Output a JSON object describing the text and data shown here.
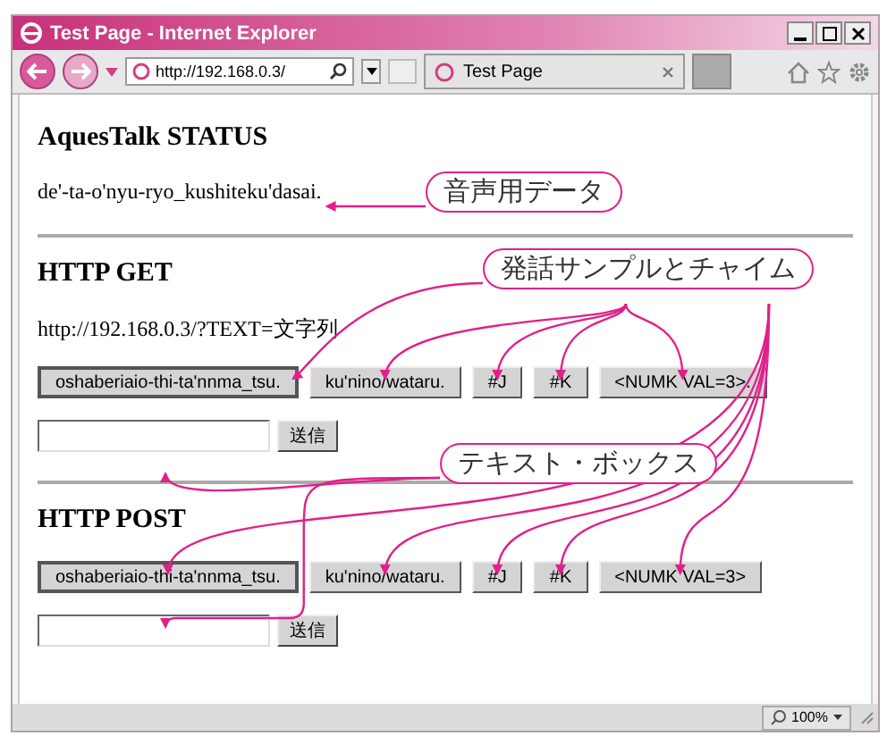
{
  "window": {
    "title": "Test Page - Internet Explorer"
  },
  "toolbar": {
    "address": "http://192.168.0.3/",
    "tab": {
      "label": "Test Page",
      "selected": true
    }
  },
  "sections": [
    {
      "kind": "status",
      "heading": "AquesTalk STATUS",
      "text": "de'-ta-o'nyu-ryo_kushiteku'dasai."
    },
    {
      "kind": "form",
      "heading": "HTTP GET",
      "url": "http://192.168.0.3/?TEXT=文字列",
      "buttons": [
        "oshaberiaio-thi-ta'nnma_tsu.",
        "ku'nino/wataru.",
        "#J",
        "#K",
        "<NUMK VAL=3>."
      ],
      "submit": "送信"
    },
    {
      "kind": "form",
      "heading": "HTTP POST",
      "buttons": [
        "oshaberiaio-thi-ta'nnma_tsu.",
        "ku'nino/wataru.",
        "#J",
        "#K",
        "<NUMK VAL=3>"
      ],
      "submit": "送信"
    }
  ],
  "callouts": [
    "音声用データ",
    "発話サンプルとチャイム",
    "テキスト・ボックス"
  ],
  "status_bar": {
    "zoom": "100%"
  }
}
